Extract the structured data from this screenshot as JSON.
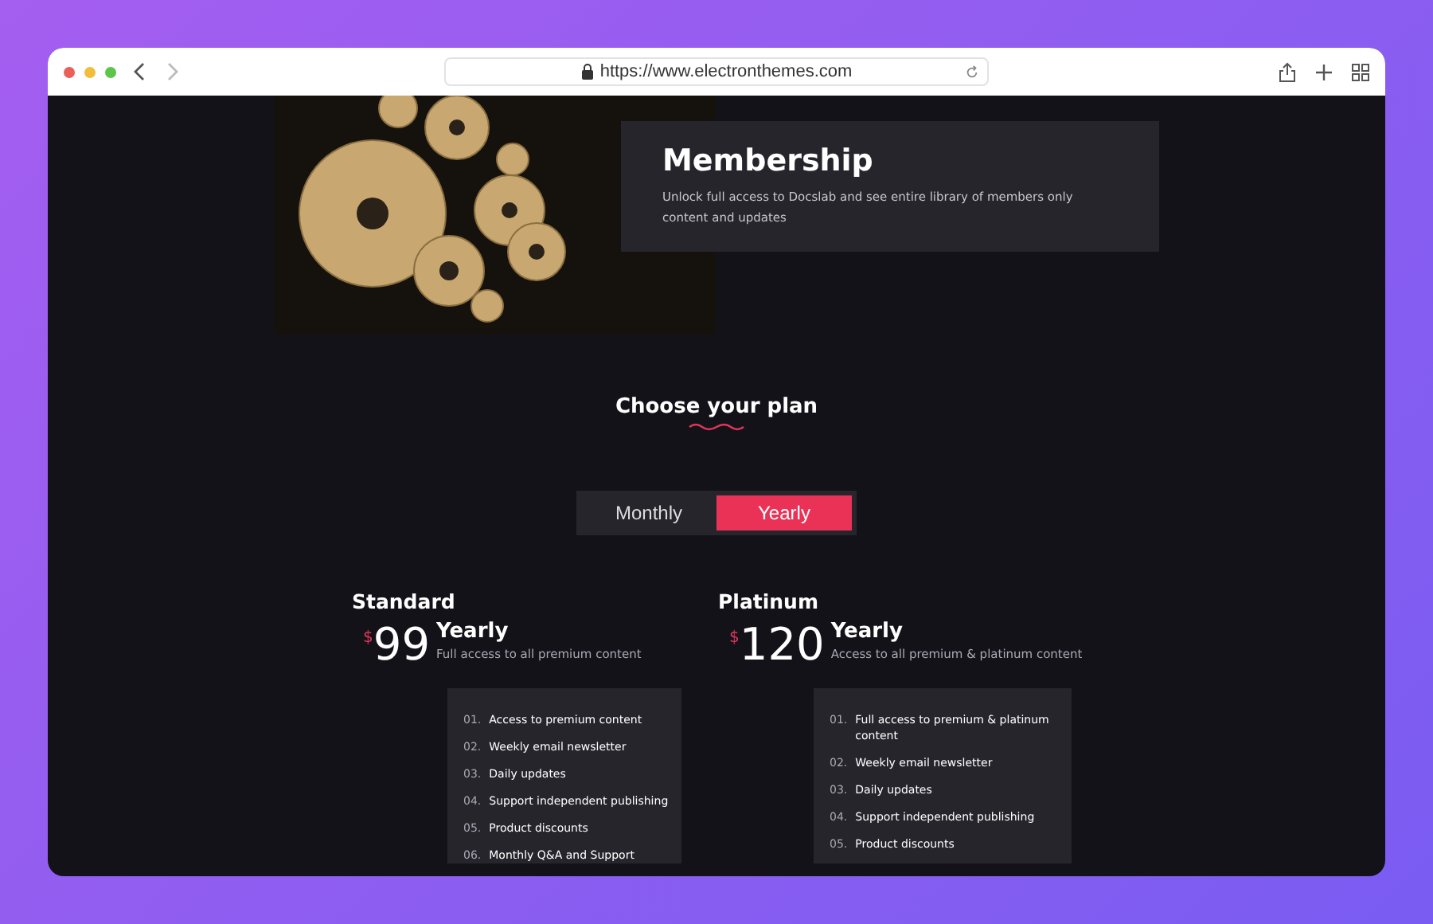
{
  "browser": {
    "url": "https://www.electronthemes.com"
  },
  "hero": {
    "title": "Membership",
    "description": "Unlock full access to Docslab and see entire library of members only content and updates"
  },
  "section_title": "Choose your plan",
  "billing_toggle": [
    {
      "label": "Monthly",
      "selected": false
    },
    {
      "label": "Yearly",
      "selected": true
    }
  ],
  "plans": [
    {
      "name": "Standard",
      "currency": "$",
      "price": "99",
      "period": "Yearly",
      "summary": "Full access to all premium content",
      "features": [
        {
          "number": "01.",
          "text": "Access to premium content"
        },
        {
          "number": "02.",
          "text": "Weekly email newsletter"
        },
        {
          "number": "03.",
          "text": "Daily updates"
        },
        {
          "number": "04.",
          "text": "Support independent publishing"
        },
        {
          "number": "05.",
          "text": "Product discounts"
        },
        {
          "number": "06.",
          "text": "Monthly Q&A and Support"
        }
      ]
    },
    {
      "name": "Platinum",
      "currency": "$",
      "price": "120",
      "period": "Yearly",
      "summary": "Access to all premium & platinum content",
      "features": [
        {
          "number": "01.",
          "text": "Full access to premium & platinum content"
        },
        {
          "number": "02.",
          "text": "Weekly email newsletter"
        },
        {
          "number": "03.",
          "text": "Daily updates"
        },
        {
          "number": "04.",
          "text": "Support independent publishing"
        },
        {
          "number": "05.",
          "text": "Product discounts"
        }
      ]
    }
  ]
}
